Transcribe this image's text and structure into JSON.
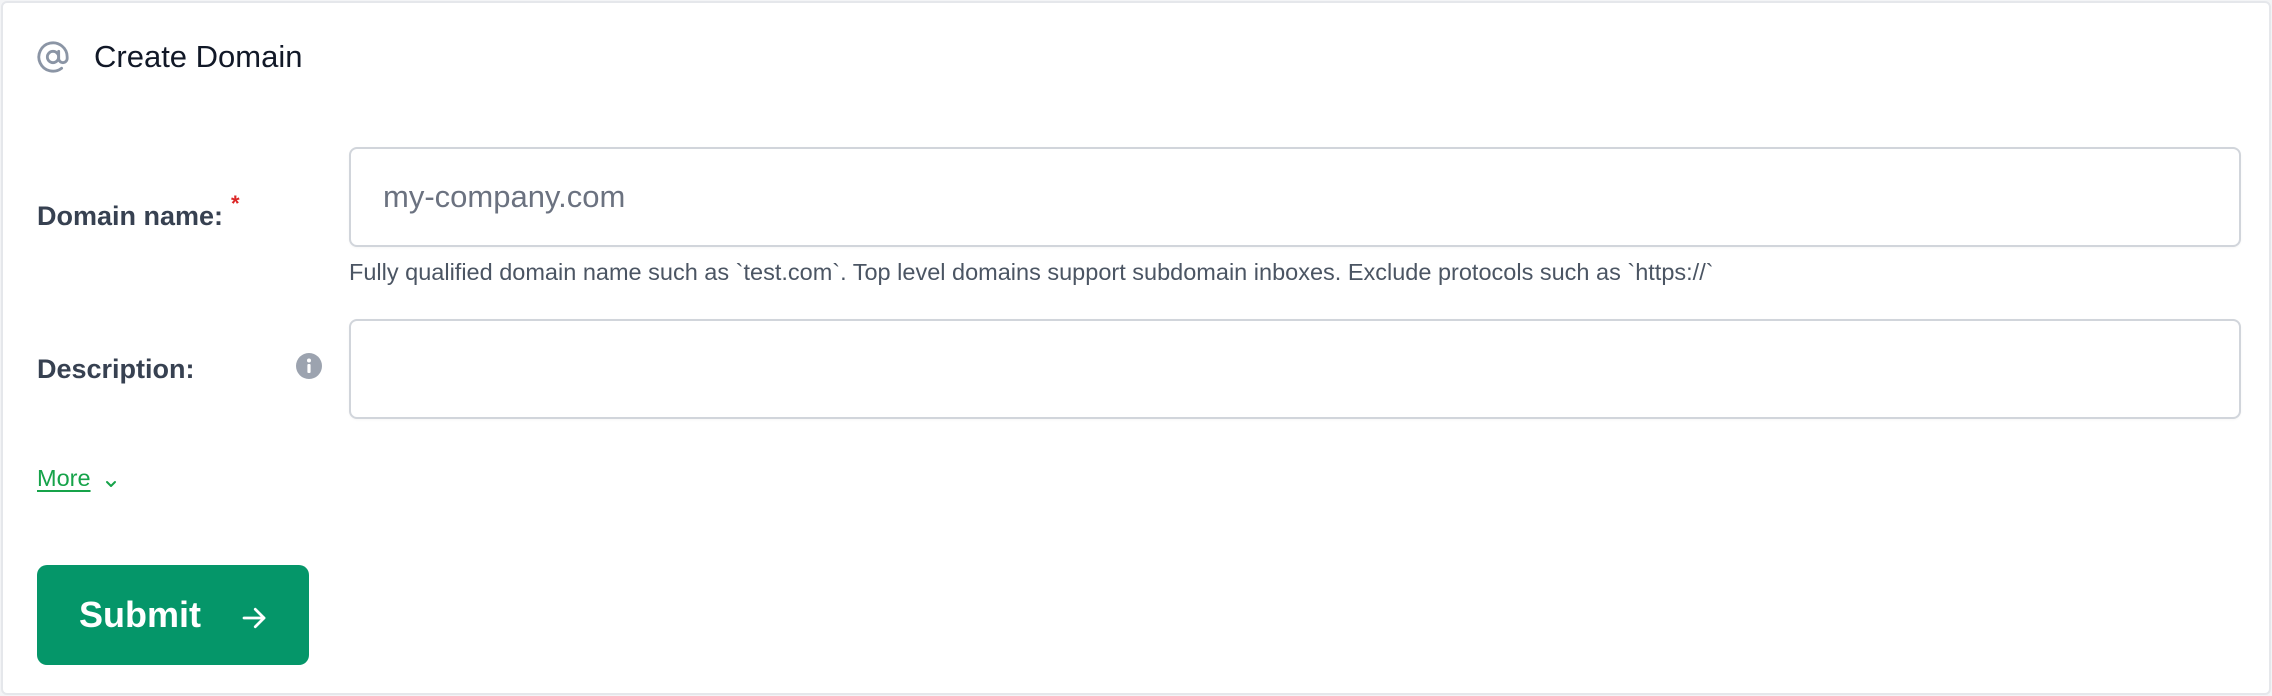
{
  "header": {
    "icon": "at-sign-icon",
    "title": "Create Domain"
  },
  "form": {
    "domain_name": {
      "label": "Domain name:",
      "required_marker": "*",
      "placeholder": "my-company.com",
      "value": "",
      "help": "Fully qualified domain name such as `test.com`. Top level domains support subdomain inboxes. Exclude protocols such as `https://`"
    },
    "description": {
      "label": "Description:",
      "info_icon": "info-icon",
      "placeholder": "",
      "value": ""
    },
    "more": {
      "label": "More",
      "icon": "chevron-down-icon"
    },
    "submit": {
      "label": "Submit",
      "icon": "arrow-right-icon"
    }
  },
  "colors": {
    "accent": "#059669",
    "link": "#16a34a",
    "required": "#dc2626",
    "icon_gray": "#8b95a5"
  }
}
